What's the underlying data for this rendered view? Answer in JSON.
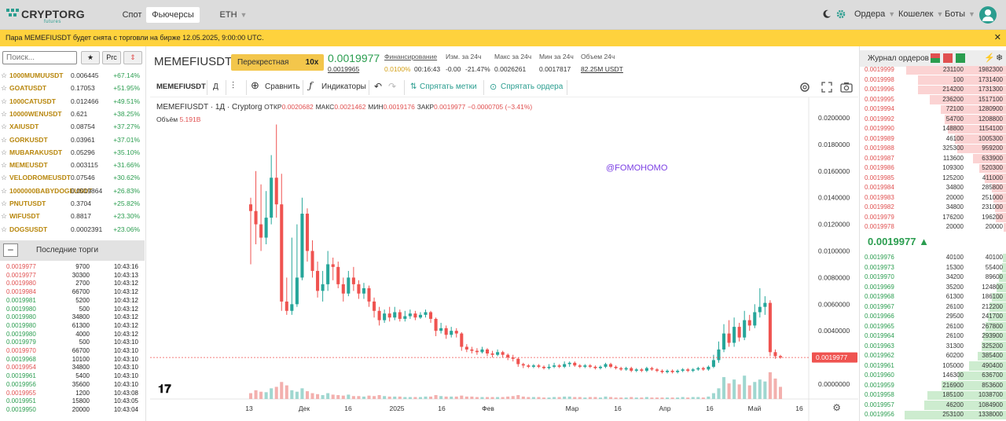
{
  "brand": {
    "name": "CRYPTORG",
    "sub": "futures"
  },
  "nav": {
    "spot": "Спот",
    "futures": "Фьючерсы",
    "coin": "ETH",
    "orders": "Ордера",
    "wallet": "Кошелек",
    "bots": "Боты"
  },
  "banner": {
    "text": "Пара MEMEFIUSDT будет снята с торговли на бирже 12.05.2025, 9:00:00 UTC."
  },
  "left": {
    "search_placeholder": "Поиск...",
    "btn_star": "★",
    "btn_prc": "Prc",
    "btn_sort": "⇕",
    "markets": [
      {
        "sym": "1000MUMUUSDT",
        "price": "0.006445",
        "chg": "+67.14%"
      },
      {
        "sym": "GOATUSDT",
        "price": "0.17053",
        "chg": "+51.95%"
      },
      {
        "sym": "1000CATUSDT",
        "price": "0.012466",
        "chg": "+49.51%"
      },
      {
        "sym": "10000WENUSDT",
        "price": "0.621",
        "chg": "+38.25%"
      },
      {
        "sym": "XAIUSDT",
        "price": "0.08754",
        "chg": "+37.27%"
      },
      {
        "sym": "GORKUSDT",
        "price": "0.03961",
        "chg": "+37.01%"
      },
      {
        "sym": "MUBARAKUSDT",
        "price": "0.05296",
        "chg": "+35.10%"
      },
      {
        "sym": "MEMEUSDT",
        "price": "0.003115",
        "chg": "+31.66%"
      },
      {
        "sym": "VELODROMEUSDT",
        "price": "0.07546",
        "chg": "+30.62%"
      },
      {
        "sym": "1000000BABYDOGEUSDT",
        "price": "0.0019864",
        "chg": "+26.83%"
      },
      {
        "sym": "PNUTUSDT",
        "price": "0.3704",
        "chg": "+25.82%"
      },
      {
        "sym": "WIFUSDT",
        "price": "0.8817",
        "chg": "+23.30%"
      },
      {
        "sym": "DOGSUSDT",
        "price": "0.0002391",
        "chg": "+23.06%"
      }
    ],
    "trades_title": "Последние торги",
    "trades": [
      {
        "p": "0.0019977",
        "q": "9700",
        "t": "10:43:16",
        "side": "sell"
      },
      {
        "p": "0.0019977",
        "q": "30300",
        "t": "10:43:13",
        "side": "sell"
      },
      {
        "p": "0.0019980",
        "q": "2700",
        "t": "10:43:12",
        "side": "sell"
      },
      {
        "p": "0.0019984",
        "q": "66700",
        "t": "10:43:12",
        "side": "sell"
      },
      {
        "p": "0.0019981",
        "q": "5200",
        "t": "10:43:12",
        "side": "buy"
      },
      {
        "p": "0.0019980",
        "q": "500",
        "t": "10:43:12",
        "side": "buy"
      },
      {
        "p": "0.0019980",
        "q": "34800",
        "t": "10:43:12",
        "side": "buy"
      },
      {
        "p": "0.0019980",
        "q": "61300",
        "t": "10:43:12",
        "side": "buy"
      },
      {
        "p": "0.0019980",
        "q": "4000",
        "t": "10:43:12",
        "side": "buy"
      },
      {
        "p": "0.0019979",
        "q": "500",
        "t": "10:43:10",
        "side": "buy"
      },
      {
        "p": "0.0019970",
        "q": "66700",
        "t": "10:43:10",
        "side": "sell"
      },
      {
        "p": "0.0019968",
        "q": "10100",
        "t": "10:43:10",
        "side": "buy"
      },
      {
        "p": "0.0019954",
        "q": "34800",
        "t": "10:43:10",
        "side": "sell"
      },
      {
        "p": "0.0019961",
        "q": "5400",
        "t": "10:43:10",
        "side": "buy"
      },
      {
        "p": "0.0019956",
        "q": "35600",
        "t": "10:43:10",
        "side": "buy"
      },
      {
        "p": "0.0019955",
        "q": "1200",
        "t": "10:43:08",
        "side": "sell"
      },
      {
        "p": "0.0019951",
        "q": "15800",
        "t": "10:43:05",
        "side": "buy"
      },
      {
        "p": "0.0019950",
        "q": "20000",
        "t": "10:43:04",
        "side": "buy"
      }
    ]
  },
  "header": {
    "pair": "MEMEFIUSDT",
    "margin_mode": "Перекрестная",
    "leverage": "10x",
    "last_price": "0.0019977",
    "index_price": "0.0019965",
    "stats": [
      {
        "label": "Финансирование",
        "value": "0.0100%",
        "value2": "00:16:43"
      },
      {
        "label": "Изм. за 24ч",
        "value": "-0.00",
        "value2": "-21.47%"
      },
      {
        "label": "Макс за 24ч",
        "value": "0.0026261"
      },
      {
        "label": "Мин за 24ч",
        "value": "0.0017817"
      },
      {
        "label": "Объем 24ч",
        "value": "82.25M USDT"
      }
    ]
  },
  "toolbar": {
    "symbol": "MEMEFIUSDT",
    "interval": "Д",
    "compare": "Сравнить",
    "indicators": "Индикаторы",
    "hide_marks": "Спрятать метки",
    "hide_orders": "Спрятать ордера"
  },
  "chart_legend": {
    "title": "MEMEFIUSDT · 1Д · Cryptorg",
    "open_label": "ОТКР",
    "open": "0.0020682",
    "high_label": "МАКС",
    "high": "0.0021462",
    "low_label": "МИН",
    "low": "0.0019176",
    "close_label": "ЗАКР",
    "close": "0.0019977",
    "change": "−0.0000705 (−3.41%)",
    "volume_label": "Объём",
    "volume": "5.191B",
    "watermark": "@FOMOHOMO"
  },
  "chart_data": {
    "type": "candlestick",
    "x_ticks": [
      "13",
      "Дек",
      "16",
      "2025",
      "16",
      "Фев",
      "Мар",
      "16",
      "Апр",
      "16",
      "Май",
      "16"
    ],
    "y_ticks": [
      "0.0200000",
      "0.0180000",
      "0.0160000",
      "0.0140000",
      "0.0120000",
      "0.0100000",
      "0.0080000",
      "0.0060000",
      "0.0040000",
      "0.0020000",
      "0.0000000"
    ],
    "ylim": [
      0,
      0.0205
    ],
    "last_price_label": "0.0019977",
    "candles": [
      [
        0.0135,
        0.013,
        0.014,
        0.009
      ],
      [
        0.013,
        0.012,
        0.016,
        0.0105
      ],
      [
        0.012,
        0.011,
        0.015,
        0.01
      ],
      [
        0.011,
        0.0125,
        0.0145,
        0.0105
      ],
      [
        0.0125,
        0.0155,
        0.0172,
        0.012
      ],
      [
        0.0155,
        0.0135,
        0.0195,
        0.0125
      ],
      [
        0.0135,
        0.0062,
        0.0158,
        0.0055
      ],
      [
        0.0062,
        0.0055,
        0.008,
        0.0052
      ],
      [
        0.0055,
        0.006,
        0.011,
        0.0052
      ],
      [
        0.006,
        0.008,
        0.012,
        0.0058
      ],
      [
        0.008,
        0.0128,
        0.014,
        0.0078
      ],
      [
        0.0128,
        0.01,
        0.0132,
        0.0092
      ],
      [
        0.01,
        0.0085,
        0.0108,
        0.008
      ],
      [
        0.0085,
        0.007,
        0.0092,
        0.0065
      ],
      [
        0.007,
        0.0075,
        0.0085,
        0.0062
      ],
      [
        0.0075,
        0.009,
        0.01,
        0.007
      ],
      [
        0.009,
        0.0088,
        0.0095,
        0.0078
      ],
      [
        0.0088,
        0.0075,
        0.0092,
        0.0072
      ],
      [
        0.0075,
        0.0068,
        0.008,
        0.0062
      ],
      [
        0.0068,
        0.008,
        0.0085,
        0.0066
      ],
      [
        0.008,
        0.0075,
        0.0088,
        0.007
      ],
      [
        0.0075,
        0.0068,
        0.0078,
        0.0064
      ],
      [
        0.0068,
        0.0072,
        0.0076,
        0.0064
      ],
      [
        0.0072,
        0.0062,
        0.0074,
        0.0058
      ],
      [
        0.0062,
        0.0055,
        0.0065,
        0.005
      ],
      [
        0.0055,
        0.0048,
        0.0058,
        0.0044
      ],
      [
        0.0048,
        0.0053,
        0.0056,
        0.0046
      ],
      [
        0.0053,
        0.005,
        0.0058,
        0.0047
      ],
      [
        0.005,
        0.0054,
        0.0058,
        0.0048
      ],
      [
        0.0054,
        0.0049,
        0.0056,
        0.0047
      ],
      [
        0.0049,
        0.0051,
        0.0055,
        0.0047
      ],
      [
        0.0051,
        0.0053,
        0.0056,
        0.0049
      ],
      [
        0.0053,
        0.005,
        0.0055,
        0.0048
      ],
      [
        0.005,
        0.0052,
        0.0054,
        0.0049
      ],
      [
        0.0052,
        0.0054,
        0.0056,
        0.005
      ],
      [
        0.0054,
        0.0049,
        0.0055,
        0.0046
      ],
      [
        0.0049,
        0.004,
        0.005,
        0.0036
      ],
      [
        0.004,
        0.0042,
        0.0046,
        0.0038
      ],
      [
        0.0042,
        0.0037,
        0.0044,
        0.0034
      ],
      [
        0.0037,
        0.004,
        0.0043,
        0.0035
      ],
      [
        0.004,
        0.0038,
        0.0042,
        0.0035
      ],
      [
        0.0038,
        0.0028,
        0.0039,
        0.0025
      ],
      [
        0.0028,
        0.0026,
        0.003,
        0.0024
      ],
      [
        0.0026,
        0.0025,
        0.0028,
        0.0023
      ],
      [
        0.0025,
        0.0024,
        0.0027,
        0.0022
      ],
      [
        0.0024,
        0.0026,
        0.0028,
        0.0023
      ],
      [
        0.0026,
        0.0023,
        0.0027,
        0.0021
      ],
      [
        0.0023,
        0.0022,
        0.0025,
        0.002
      ],
      [
        0.0022,
        0.0024,
        0.0026,
        0.0021
      ],
      [
        0.0024,
        0.0022,
        0.0025,
        0.002
      ],
      [
        0.0022,
        0.002,
        0.0023,
        0.0018
      ],
      [
        0.002,
        0.0019,
        0.0022,
        0.0017
      ],
      [
        0.0019,
        0.0015,
        0.002,
        0.0013
      ],
      [
        0.0015,
        0.0014,
        0.0016,
        0.0012
      ],
      [
        0.0014,
        0.0013,
        0.0015,
        0.0012
      ],
      [
        0.0013,
        0.0014,
        0.0015,
        0.0012
      ],
      [
        0.0014,
        0.0013,
        0.0015,
        0.0012
      ],
      [
        0.0013,
        0.0012,
        0.0014,
        0.0011
      ],
      [
        0.0012,
        0.0013,
        0.0015,
        0.0011
      ],
      [
        0.0013,
        0.0014,
        0.0016,
        0.0012
      ],
      [
        0.0014,
        0.0013,
        0.0015,
        0.0012
      ],
      [
        0.0013,
        0.0015,
        0.0017,
        0.0012
      ],
      [
        0.0015,
        0.0016,
        0.0017,
        0.0013
      ],
      [
        0.0016,
        0.0014,
        0.0017,
        0.0013
      ],
      [
        0.0014,
        0.0013,
        0.0015,
        0.0012
      ],
      [
        0.0013,
        0.0014,
        0.0015,
        0.0012
      ],
      [
        0.0014,
        0.0013,
        0.0015,
        0.0012
      ],
      [
        0.0013,
        0.0012,
        0.0014,
        0.0011
      ],
      [
        0.0012,
        0.0013,
        0.0014,
        0.0011
      ],
      [
        0.0013,
        0.0015,
        0.0016,
        0.0012
      ],
      [
        0.0015,
        0.0013,
        0.0016,
        0.0012
      ],
      [
        0.0013,
        0.0012,
        0.0014,
        0.0011
      ],
      [
        0.0012,
        0.0011,
        0.0013,
        0.001
      ],
      [
        0.0011,
        0.0012,
        0.0013,
        0.001
      ],
      [
        0.0012,
        0.001,
        0.0013,
        0.0009
      ],
      [
        0.001,
        0.0011,
        0.0012,
        0.0009
      ],
      [
        0.0011,
        0.001,
        0.0012,
        0.0009
      ],
      [
        0.001,
        0.0012,
        0.0013,
        0.0009
      ],
      [
        0.0012,
        0.0011,
        0.0013,
        0.001
      ],
      [
        0.0011,
        0.001,
        0.0012,
        0.0009
      ],
      [
        0.001,
        0.0009,
        0.0011,
        0.0008
      ],
      [
        0.0009,
        0.001,
        0.0011,
        0.0008
      ],
      [
        0.001,
        0.0009,
        0.0011,
        0.0008
      ],
      [
        0.0009,
        0.001,
        0.0011,
        0.0008
      ],
      [
        0.001,
        0.0011,
        0.0012,
        0.0009
      ],
      [
        0.0011,
        0.001,
        0.0012,
        0.0009
      ],
      [
        0.001,
        0.0011,
        0.0012,
        0.0009
      ],
      [
        0.0011,
        0.0012,
        0.0013,
        0.001
      ],
      [
        0.0012,
        0.0011,
        0.0013,
        0.001
      ],
      [
        0.0011,
        0.0013,
        0.0014,
        0.001
      ],
      [
        0.0013,
        0.0018,
        0.0022,
        0.0012
      ],
      [
        0.0018,
        0.0026,
        0.0032,
        0.0016
      ],
      [
        0.0026,
        0.0038,
        0.0045,
        0.0024
      ],
      [
        0.0038,
        0.0031,
        0.0048,
        0.0028
      ],
      [
        0.0031,
        0.0043,
        0.005,
        0.0028
      ],
      [
        0.0043,
        0.0035,
        0.0046,
        0.0032
      ],
      [
        0.0035,
        0.0048,
        0.0055,
        0.0033
      ],
      [
        0.0048,
        0.0044,
        0.0052,
        0.004
      ],
      [
        0.0044,
        0.0054,
        0.006,
        0.0042
      ],
      [
        0.0054,
        0.0058,
        0.0072,
        0.005
      ],
      [
        0.0058,
        0.0061,
        0.0066,
        0.0052
      ],
      [
        0.0061,
        0.0024,
        0.0063,
        0.0021
      ],
      [
        0.0024,
        0.0021,
        0.0026,
        0.0019
      ],
      [
        0.0021,
        0.002,
        0.0022,
        0.0019
      ]
    ],
    "volume": [
      0.12,
      0.18,
      0.15,
      0.14,
      0.22,
      0.25,
      0.35,
      0.28,
      0.18,
      0.15,
      0.22,
      0.16,
      0.12,
      0.1,
      0.08,
      0.12,
      0.09,
      0.08,
      0.07,
      0.09,
      0.06,
      0.06,
      0.05,
      0.07,
      0.06,
      0.08,
      0.06,
      0.05,
      0.05,
      0.05,
      0.04,
      0.04,
      0.04,
      0.04,
      0.05,
      0.05,
      0.08,
      0.06,
      0.05,
      0.05,
      0.05,
      0.07,
      0.05,
      0.05,
      0.04,
      0.04,
      0.04,
      0.04,
      0.04,
      0.04,
      0.05,
      0.06,
      0.08,
      0.05,
      0.04,
      0.04,
      0.04,
      0.03,
      0.03,
      0.04,
      0.04,
      0.05,
      0.05,
      0.04,
      0.04,
      0.03,
      0.04,
      0.04,
      0.03,
      0.05,
      0.04,
      0.03,
      0.03,
      0.03,
      0.04,
      0.03,
      0.03,
      0.04,
      0.03,
      0.03,
      0.03,
      0.03,
      0.03,
      0.03,
      0.04,
      0.03,
      0.04,
      0.04,
      0.03,
      0.05,
      0.12,
      0.22,
      0.45,
      0.32,
      0.4,
      0.3,
      0.48,
      0.28,
      0.35,
      0.4,
      0.36,
      0.55,
      0.42,
      0.25,
      0.15
    ]
  },
  "orderbook": {
    "title": "Журнал ордеров",
    "asks": [
      {
        "p": "0.0019999",
        "a": "231100",
        "s": "1982300",
        "w": 0.98
      },
      {
        "p": "0.0019998",
        "a": "100",
        "s": "1731400",
        "w": 0.86
      },
      {
        "p": "0.0019996",
        "a": "214200",
        "s": "1731300",
        "w": 0.86
      },
      {
        "p": "0.0019995",
        "a": "236200",
        "s": "1517100",
        "w": 0.75
      },
      {
        "p": "0.0019994",
        "a": "72100",
        "s": "1280900",
        "w": 0.64
      },
      {
        "p": "0.0019992",
        "a": "54700",
        "s": "1208800",
        "w": 0.6
      },
      {
        "p": "0.0019990",
        "a": "148800",
        "s": "1154100",
        "w": 0.57
      },
      {
        "p": "0.0019989",
        "a": "46100",
        "s": "1005300",
        "w": 0.5
      },
      {
        "p": "0.0019988",
        "a": "325300",
        "s": "959200",
        "w": 0.48
      },
      {
        "p": "0.0019987",
        "a": "113600",
        "s": "633900",
        "w": 0.32
      },
      {
        "p": "0.0019986",
        "a": "109300",
        "s": "520300",
        "w": 0.26
      },
      {
        "p": "0.0019985",
        "a": "125200",
        "s": "411000",
        "w": 0.21
      },
      {
        "p": "0.0019984",
        "a": "34800",
        "s": "285800",
        "w": 0.14
      },
      {
        "p": "0.0019983",
        "a": "20000",
        "s": "251000",
        "w": 0.12
      },
      {
        "p": "0.0019982",
        "a": "34800",
        "s": "231000",
        "w": 0.11
      },
      {
        "p": "0.0019979",
        "a": "176200",
        "s": "196200",
        "w": 0.1
      },
      {
        "p": "0.0019978",
        "a": "20000",
        "s": "20000",
        "w": 0.02
      }
    ],
    "mid_price": "0.0019977 ▲",
    "bids": [
      {
        "p": "0.0019976",
        "a": "40100",
        "s": "40100",
        "w": 0.03
      },
      {
        "p": "0.0019973",
        "a": "15300",
        "s": "55400",
        "w": 0.04
      },
      {
        "p": "0.0019970",
        "a": "34200",
        "s": "89600",
        "w": 0.07
      },
      {
        "p": "0.0019969",
        "a": "35200",
        "s": "124800",
        "w": 0.09
      },
      {
        "p": "0.0019968",
        "a": "61300",
        "s": "186100",
        "w": 0.14
      },
      {
        "p": "0.0019967",
        "a": "26100",
        "s": "212200",
        "w": 0.16
      },
      {
        "p": "0.0019966",
        "a": "29500",
        "s": "241700",
        "w": 0.18
      },
      {
        "p": "0.0019965",
        "a": "26100",
        "s": "267800",
        "w": 0.2
      },
      {
        "p": "0.0019964",
        "a": "26100",
        "s": "293900",
        "w": 0.22
      },
      {
        "p": "0.0019963",
        "a": "31300",
        "s": "325200",
        "w": 0.24
      },
      {
        "p": "0.0019962",
        "a": "60200",
        "s": "385400",
        "w": 0.28
      },
      {
        "p": "0.0019961",
        "a": "105000",
        "s": "490400",
        "w": 0.36
      },
      {
        "p": "0.0019960",
        "a": "146300",
        "s": "636700",
        "w": 0.47
      },
      {
        "p": "0.0019959",
        "a": "216900",
        "s": "853600",
        "w": 0.63
      },
      {
        "p": "0.0019958",
        "a": "185100",
        "s": "1038700",
        "w": 0.77
      },
      {
        "p": "0.0019957",
        "a": "46200",
        "s": "1084900",
        "w": 0.8
      },
      {
        "p": "0.0019956",
        "a": "253100",
        "s": "1338000",
        "w": 0.99
      }
    ]
  },
  "colors": {
    "up": "#26a69a",
    "down": "#ef5350",
    "accent": "#2a9d8f",
    "banner": "#fed23d"
  }
}
